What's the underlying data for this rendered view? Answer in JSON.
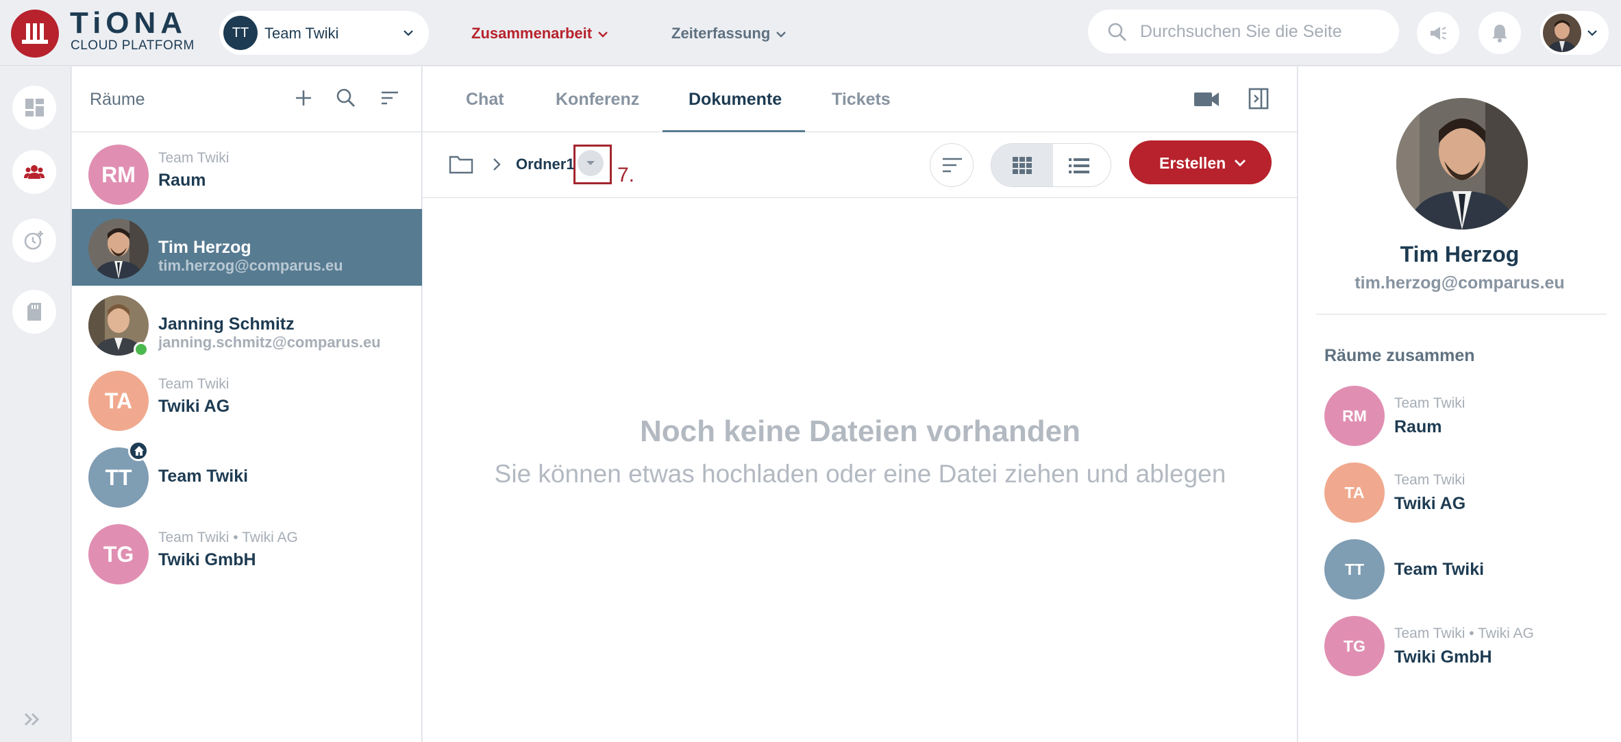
{
  "app": {
    "logo_text": "TiONA",
    "logo_sub": "CLOUD PLATFORM",
    "brand_color": "#b7222c"
  },
  "header": {
    "team_initials": "TT",
    "team_name": "Team Twiki",
    "nav": [
      {
        "label": "Zusammenarbeit",
        "active": true
      },
      {
        "label": "Zeiterfassung",
        "active": false
      }
    ],
    "search_placeholder": "Durchsuchen Sie die Seite"
  },
  "rooms": {
    "title": "Räume",
    "items": [
      {
        "initials": "RM",
        "sub": "Team Twiki",
        "name": "Raum",
        "color": "#e08fb2"
      },
      {
        "photo": true,
        "name": "Tim Herzog",
        "email": "tim.herzog@comparus.eu",
        "active": true
      },
      {
        "photo": true,
        "name": "Janning Schmitz",
        "email": "janning.schmitz@comparus.eu",
        "online": true
      },
      {
        "initials": "TA",
        "sub": "Team Twiki",
        "name": "Twiki AG",
        "color": "#f0a98e"
      },
      {
        "initials": "TT",
        "name": "Team Twiki",
        "color": "#7f9db3",
        "home": true
      },
      {
        "initials": "TG",
        "sub": "Team Twiki • Twiki AG",
        "name": "Twiki GmbH",
        "color": "#e08fb2"
      }
    ]
  },
  "main": {
    "tabs": [
      "Chat",
      "Konferenz",
      "Dokumente",
      "Tickets"
    ],
    "active_tab": "Dokumente",
    "breadcrumb_folder": "Ordner1",
    "annotation_number": "7.",
    "create_label": "Erstellen",
    "empty_title": "Noch keine Dateien vorhanden",
    "empty_subtitle": "Sie können etwas hochladen oder eine Datei ziehen und ablegen"
  },
  "profile": {
    "name": "Tim Herzog",
    "email": "tim.herzog@comparus.eu",
    "section_title": "Räume zusammen",
    "rooms": [
      {
        "initials": "RM",
        "sub": "Team Twiki",
        "name": "Raum",
        "color": "#e08fb2"
      },
      {
        "initials": "TA",
        "sub": "Team Twiki",
        "name": "Twiki AG",
        "color": "#f0a98e"
      },
      {
        "initials": "TT",
        "name": "Team Twiki",
        "color": "#7f9db3"
      },
      {
        "initials": "TG",
        "sub": "Team Twiki • Twiki AG",
        "name": "Twiki GmbH",
        "color": "#e08fb2"
      }
    ]
  }
}
